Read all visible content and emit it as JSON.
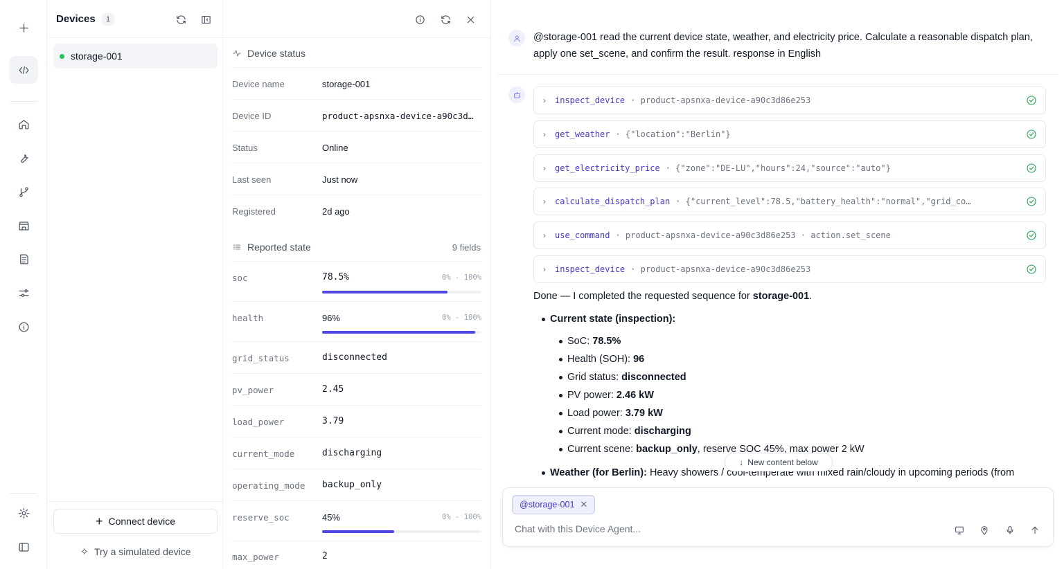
{
  "devices_panel": {
    "title": "Devices",
    "count": "1",
    "items": [
      {
        "name": "storage-001",
        "status_color": "#22c55e"
      }
    ],
    "connect_label": "Connect device",
    "simulated_label": "Try a simulated device"
  },
  "status_panel": {
    "device_status_title": "Device status",
    "info": [
      {
        "key": "Device name",
        "value": "storage-001"
      },
      {
        "key": "Device ID",
        "value": "product-apsnxa-device-a90c3d…"
      },
      {
        "key": "Status",
        "value": "Online"
      },
      {
        "key": "Last seen",
        "value": "Just now"
      },
      {
        "key": "Registered",
        "value": "2d ago"
      }
    ],
    "reported_title": "Reported state",
    "fields_count": "9 fields",
    "reported": [
      {
        "key": "soc",
        "value": "78.5%",
        "range": "0% - 100%",
        "progress": 0.785
      },
      {
        "key": "health",
        "value": "96%",
        "range": "0% - 100%",
        "progress": 0.96
      },
      {
        "key": "grid_status",
        "value": "disconnected"
      },
      {
        "key": "pv_power",
        "value": "2.45"
      },
      {
        "key": "load_power",
        "value": "3.79"
      },
      {
        "key": "current_mode",
        "value": "discharging"
      },
      {
        "key": "operating_mode",
        "value": "backup_only"
      },
      {
        "key": "reserve_soc",
        "value": "45%",
        "range": "0% - 100%",
        "progress": 0.45
      },
      {
        "key": "max_power",
        "value": "2"
      }
    ]
  },
  "chat": {
    "user_message": "@storage-001 read the current device state, weather, and electricity price. Calculate a reasonable dispatch plan, apply one set_scene, and confirm the result. response in English",
    "tool_calls": [
      {
        "name": "inspect_device",
        "args": "·  product-apsnxa-device-a90c3d86e253"
      },
      {
        "name": "get_weather",
        "args": "·  {\"location\":\"Berlin\"}"
      },
      {
        "name": "get_electricity_price",
        "args": "·  {\"zone\":\"DE-LU\",\"hours\":24,\"source\":\"auto\"}"
      },
      {
        "name": "calculate_dispatch_plan",
        "args": "·  {\"current_level\":78.5,\"battery_health\":\"normal\",\"grid_co…"
      },
      {
        "name": "use_command",
        "args": "·  product-apsnxa-device-a90c3d86e253  ·  action.set_scene"
      },
      {
        "name": "inspect_device",
        "args": "·  product-apsnxa-device-a90c3d86e253"
      }
    ],
    "answer": {
      "intro_pre": "Done — I completed the requested sequence for ",
      "intro_bold": "storage-001",
      "intro_post": ".",
      "current_state_title": "Current state (inspection):",
      "items": [
        {
          "label": "SoC: ",
          "value": "78.5%",
          "rest": ""
        },
        {
          "label": "Health (SOH): ",
          "value": "96",
          "rest": ""
        },
        {
          "label": "Grid status: ",
          "value": "disconnected",
          "rest": ""
        },
        {
          "label": "PV power: ",
          "value": "2.46 kW",
          "rest": ""
        },
        {
          "label": "Load power: ",
          "value": "3.79 kW",
          "rest": ""
        },
        {
          "label": "Current mode: ",
          "value": "discharging",
          "rest": ""
        },
        {
          "label": "Current scene: ",
          "value": "backup_only",
          "rest": ", reserve SOC 45%, max power 2 kW"
        }
      ],
      "weather_title": "Weather (for Berlin):",
      "weather_text": " Heavy showers / cool-temperate with mixed rain/cloudy in upcoming periods (from"
    },
    "new_content_label": "New content below",
    "composer": {
      "chip": "@storage-001",
      "placeholder": "Chat with this Device Agent..."
    }
  },
  "colors": {
    "accent": "#4f46e5",
    "online": "#22c55e",
    "success": "#16a34a"
  }
}
